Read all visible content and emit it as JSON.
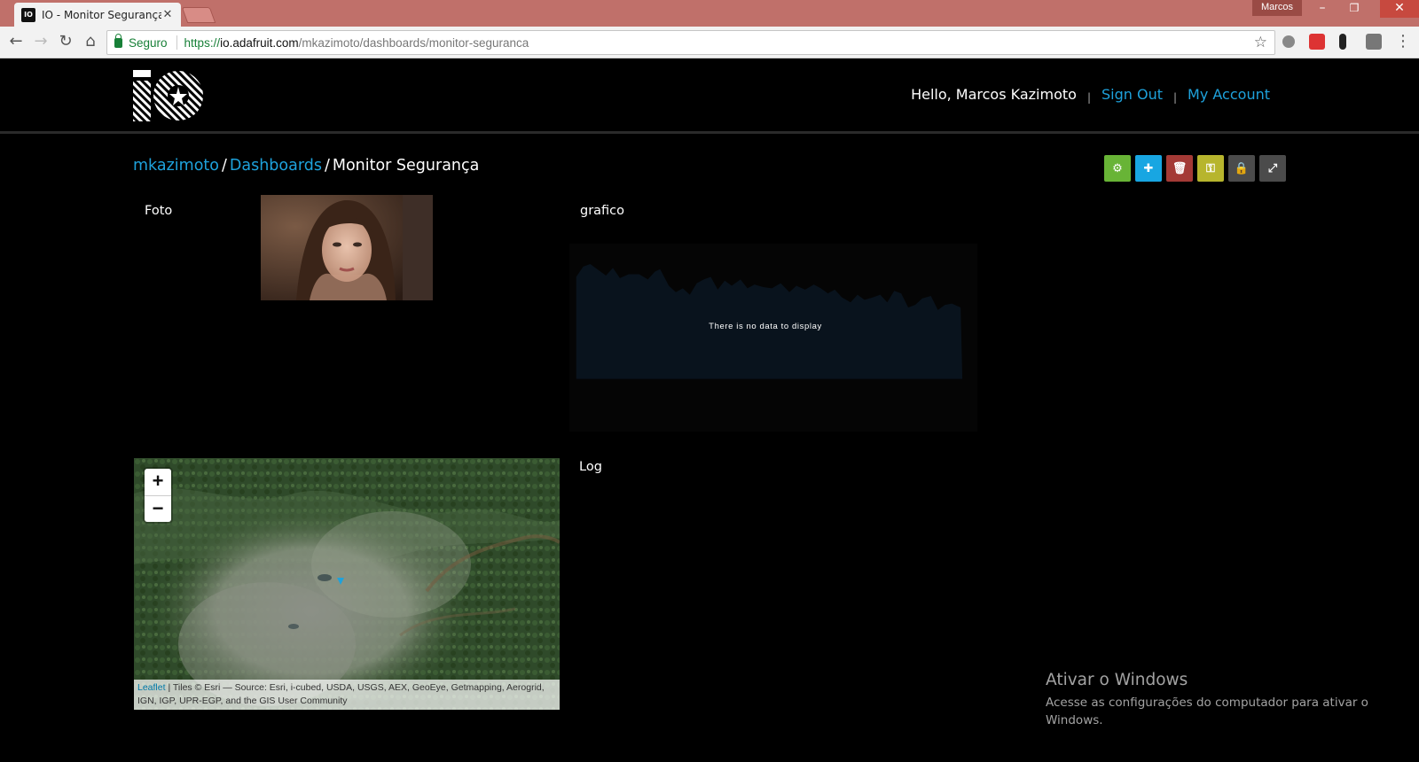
{
  "browser": {
    "tab_title": "IO - Monitor Segurança",
    "tab_close": "✕",
    "favicon_text": "IO",
    "user_badge": "Marcos",
    "window_controls": [
      "–",
      "❐",
      "✕"
    ],
    "secure_label": "Seguro",
    "url_scheme": "https://",
    "url_host": "io.adafruit.com",
    "url_path": "/mkazimoto/dashboards/monitor-seguranca",
    "icons": [
      "back-icon",
      "forward-icon",
      "reload-icon",
      "home-icon",
      "star-icon"
    ]
  },
  "header": {
    "hello": "Hello, Marcos Kazimoto",
    "separator": "|",
    "sign_out": "Sign Out",
    "my_account": "My Account"
  },
  "breadcrumb": {
    "user": "mkazimoto",
    "section": "Dashboards",
    "current": "Monitor Segurança",
    "separator": "/"
  },
  "toolbar": [
    {
      "name": "settings-button",
      "icon": "⚙",
      "color": "#68b436"
    },
    {
      "name": "add-block-button",
      "icon": "✚",
      "color": "#18a6e2"
    },
    {
      "name": "delete-button",
      "icon": "🗑",
      "color": "#a43a36"
    },
    {
      "name": "key-button",
      "icon": "⚿",
      "color": "#b7b52d"
    },
    {
      "name": "lock-button",
      "icon": "🔒",
      "color": "#4b4b4b"
    },
    {
      "name": "fullscreen-button",
      "icon": "⤢",
      "color": "#4b4b4b"
    }
  ],
  "blocks": {
    "photo_label": "Foto",
    "chart_label": "grafico",
    "chart_empty": "There is no data to display",
    "log_label": "Log"
  },
  "map": {
    "zoom_in": "+",
    "zoom_out": "−",
    "attribution_link": "Leaflet",
    "attribution_text": " | Tiles © Esri — Source: Esri, i-cubed, USDA, USGS, AEX, GeoEye, Getmapping, Aerogrid, IGN, IGP, UPR-EGP, and the GIS User Community"
  },
  "watermark": {
    "title": "Ativar o Windows",
    "text": "Acesse as configurações do computador para ativar o Windows."
  },
  "colors": {
    "accent": "#1ea2dc",
    "titlebar": "#c0706a",
    "secure": "#188038"
  }
}
